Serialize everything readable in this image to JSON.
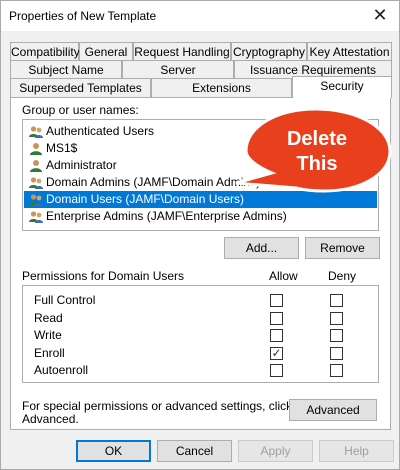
{
  "window": {
    "title": "Properties of New Template"
  },
  "tabs_row1": [
    "Compatibility",
    "General",
    "Request Handling",
    "Cryptography",
    "Key Attestation"
  ],
  "tabs_row2": [
    "Subject Name",
    "Server",
    "Issuance Requirements"
  ],
  "tabs_row3": [
    "Superseded Templates",
    "Extensions",
    "Security"
  ],
  "active_tab": "Security",
  "groups": {
    "label": "Group or user names:",
    "items": [
      "Authenticated Users",
      "MS1$",
      "Administrator",
      "Domain Admins (JAMF\\Domain Admins)",
      "Domain Users (JAMF\\Domain Users)",
      "Enterprise Admins (JAMF\\Enterprise Admins)"
    ],
    "selected_index": 4,
    "add_label": "Add...",
    "remove_label": "Remove"
  },
  "callout": {
    "line1": "Delete",
    "line2": "This",
    "color": "#e8401c"
  },
  "permissions": {
    "label": "Permissions for Domain Users",
    "allow_label": "Allow",
    "deny_label": "Deny",
    "rows": [
      {
        "name": "Full Control",
        "allow": false,
        "deny": false
      },
      {
        "name": "Read",
        "allow": false,
        "deny": false
      },
      {
        "name": "Write",
        "allow": false,
        "deny": false
      },
      {
        "name": "Enroll",
        "allow": true,
        "deny": false
      },
      {
        "name": "Autoenroll",
        "allow": false,
        "deny": false
      }
    ]
  },
  "advanced": {
    "text_line1": "For special permissions or advanced settings, click",
    "text_line2": "Advanced.",
    "button_label": "Advanced"
  },
  "footer": {
    "ok_label": "OK",
    "cancel_label": "Cancel",
    "apply_label": "Apply",
    "help_label": "Help"
  },
  "colors": {
    "selection": "#0078d7",
    "callout": "#e8401c"
  }
}
